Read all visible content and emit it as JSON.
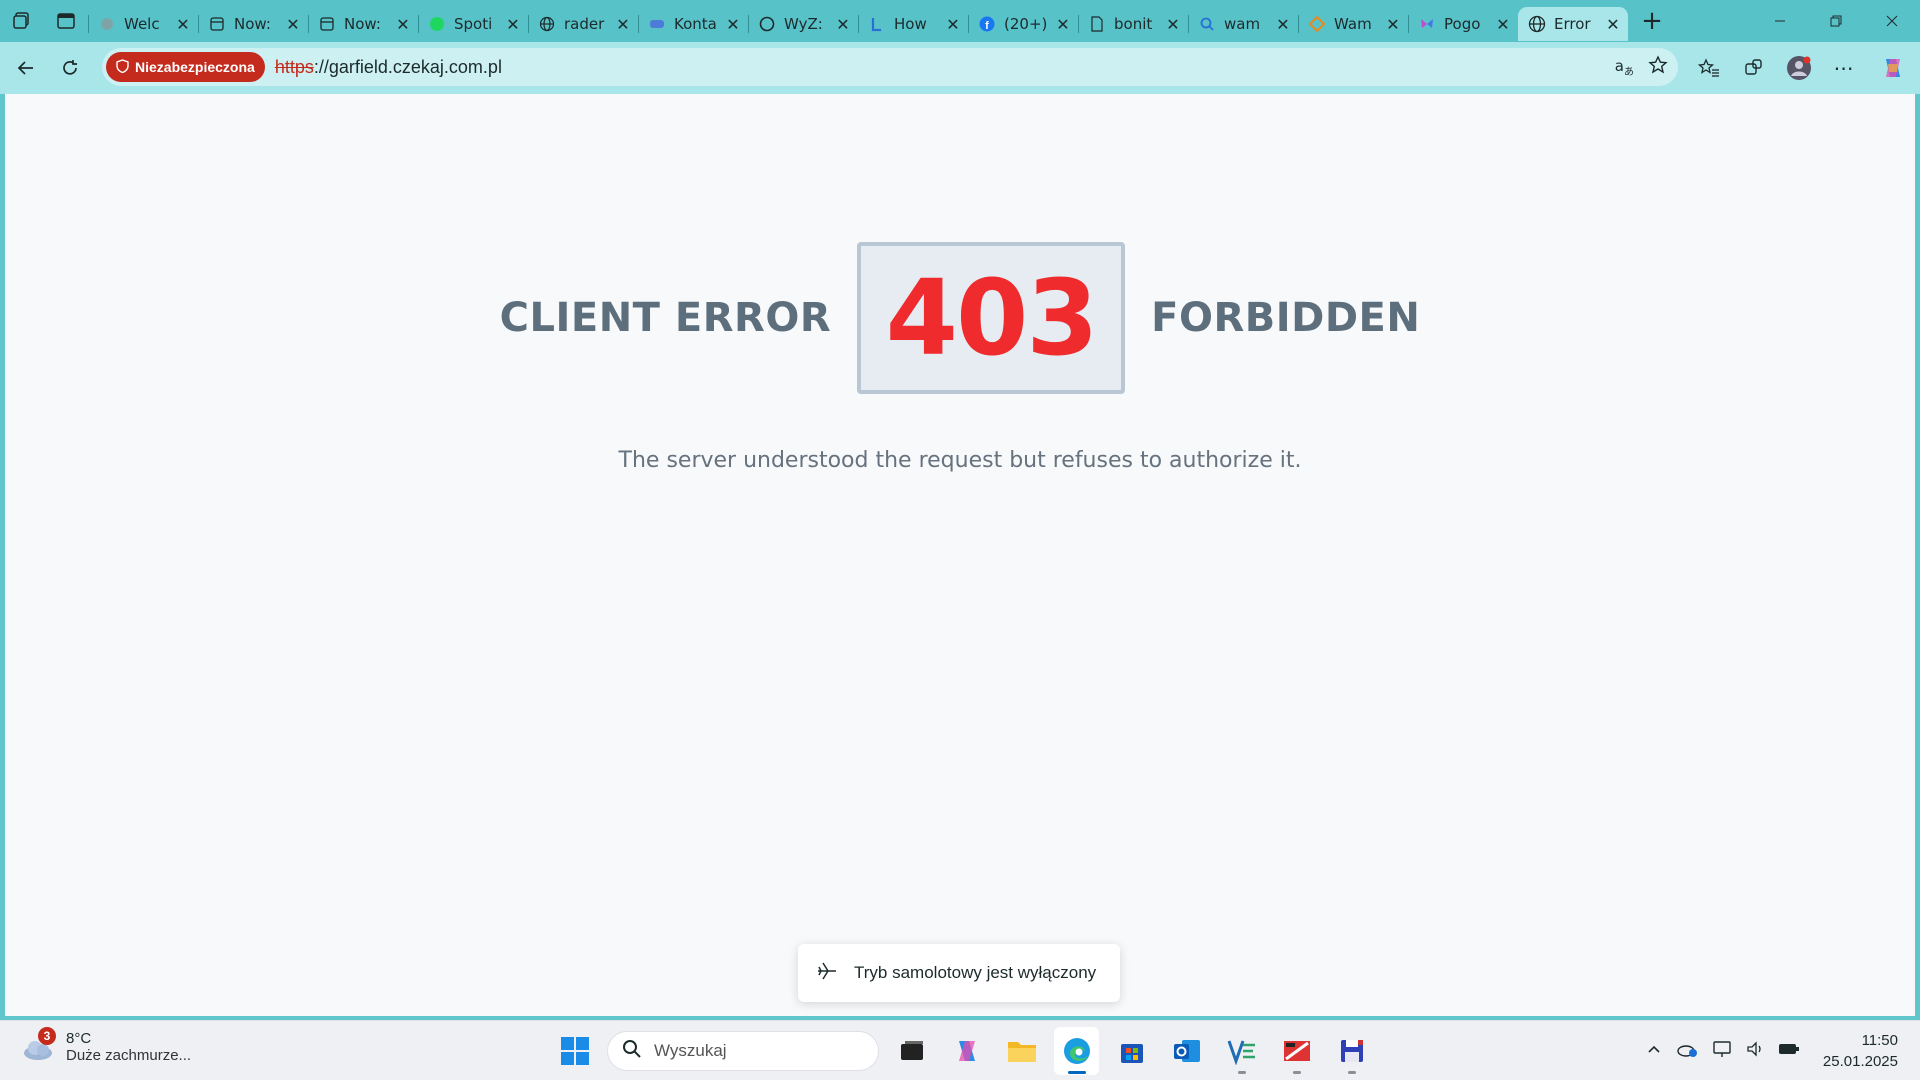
{
  "browser": {
    "tabs": [
      {
        "title": "Welc",
        "icon": "generic-site-icon"
      },
      {
        "title": "Now:",
        "icon": "page-icon"
      },
      {
        "title": "Now:",
        "icon": "page-icon"
      },
      {
        "title": "Spoti",
        "icon": "spotify-icon"
      },
      {
        "title": "rader",
        "icon": "globe-icon"
      },
      {
        "title": "Konta",
        "icon": "contact-icon"
      },
      {
        "title": "WyZ:",
        "icon": "github-icon"
      },
      {
        "title": "How",
        "icon": "l-logo-icon"
      },
      {
        "title": "(20+)",
        "icon": "facebook-icon"
      },
      {
        "title": "bonit",
        "icon": "document-icon"
      },
      {
        "title": "wam",
        "icon": "search-icon"
      },
      {
        "title": "Wam",
        "icon": "diamond-icon"
      },
      {
        "title": "Pogo",
        "icon": "butterfly-icon"
      },
      {
        "title": "Error",
        "icon": "globe-icon",
        "active": true
      }
    ],
    "security_badge": "Niezabezpieczona",
    "url_scheme": "https",
    "url_rest": "://garfield.czekaj.com.pl",
    "colors": {
      "frame": "#58c2c9",
      "toolbar": "#a8e6ea",
      "insecure": "#c42b1c"
    }
  },
  "page": {
    "left_label": "CLIENT ERROR",
    "code": "403",
    "right_label": "FORBIDDEN",
    "message": "The server understood the request but refuses to authorize it.",
    "colors": {
      "code": "#ef2b2d",
      "label": "#5d6e7c"
    }
  },
  "toast": {
    "text": "Tryb samolotowy jest wyłączony",
    "icon": "airplane-icon"
  },
  "taskbar": {
    "weather_temp": "8°C",
    "weather_desc": "Duże zachmurze...",
    "weather_badge": "3",
    "search_placeholder": "Wyszukaj",
    "time": "11:50",
    "date": "25.01.2025"
  }
}
